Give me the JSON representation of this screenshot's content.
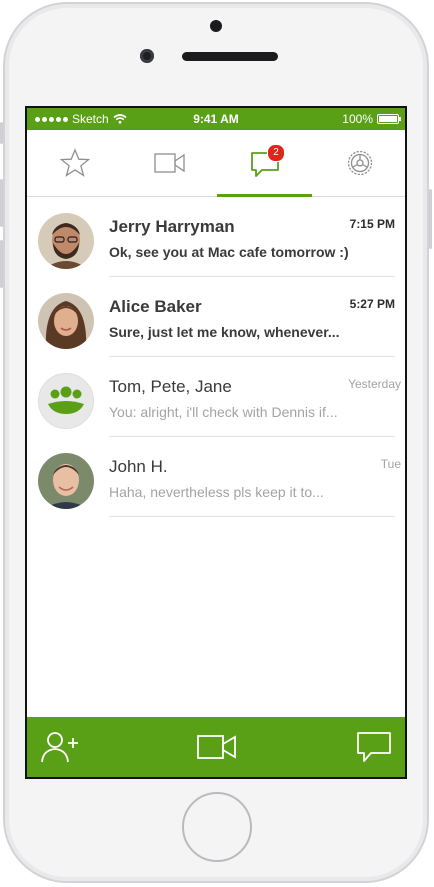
{
  "status_bar": {
    "carrier": "Sketch",
    "time": "9:41 AM",
    "battery": "100%"
  },
  "tabs": [
    {
      "icon": "star-icon",
      "label": "Favorites"
    },
    {
      "icon": "video-camera-icon",
      "label": "Video"
    },
    {
      "icon": "chat-bubble-icon",
      "label": "Chats",
      "badge": "2",
      "active": true
    },
    {
      "icon": "gear-icon",
      "label": "Settings"
    }
  ],
  "conversations": [
    {
      "name": "Jerry Harryman",
      "message": "Ok, see you at Mac cafe tomorrow :)",
      "time": "7:15 PM",
      "unread": true
    },
    {
      "name": "Alice Baker",
      "message": "Sure, just let me know, whenever...",
      "time": "5:27 PM",
      "unread": true
    },
    {
      "name": "Tom, Pete, Jane",
      "message": "You: alright, i'll check with Dennis if...",
      "time": "Yesterday",
      "unread": false
    },
    {
      "name": "John H.",
      "message": "Haha, nevertheless pls keep it to...",
      "time": "Tue",
      "unread": false
    }
  ],
  "bottom_bar": {
    "add_contact_icon": "add-contact-icon",
    "video_icon": "video-camera-icon",
    "compose_icon": "chat-bubble-icon"
  },
  "colors": {
    "accent": "#5aa017",
    "badge": "#e0261b"
  }
}
